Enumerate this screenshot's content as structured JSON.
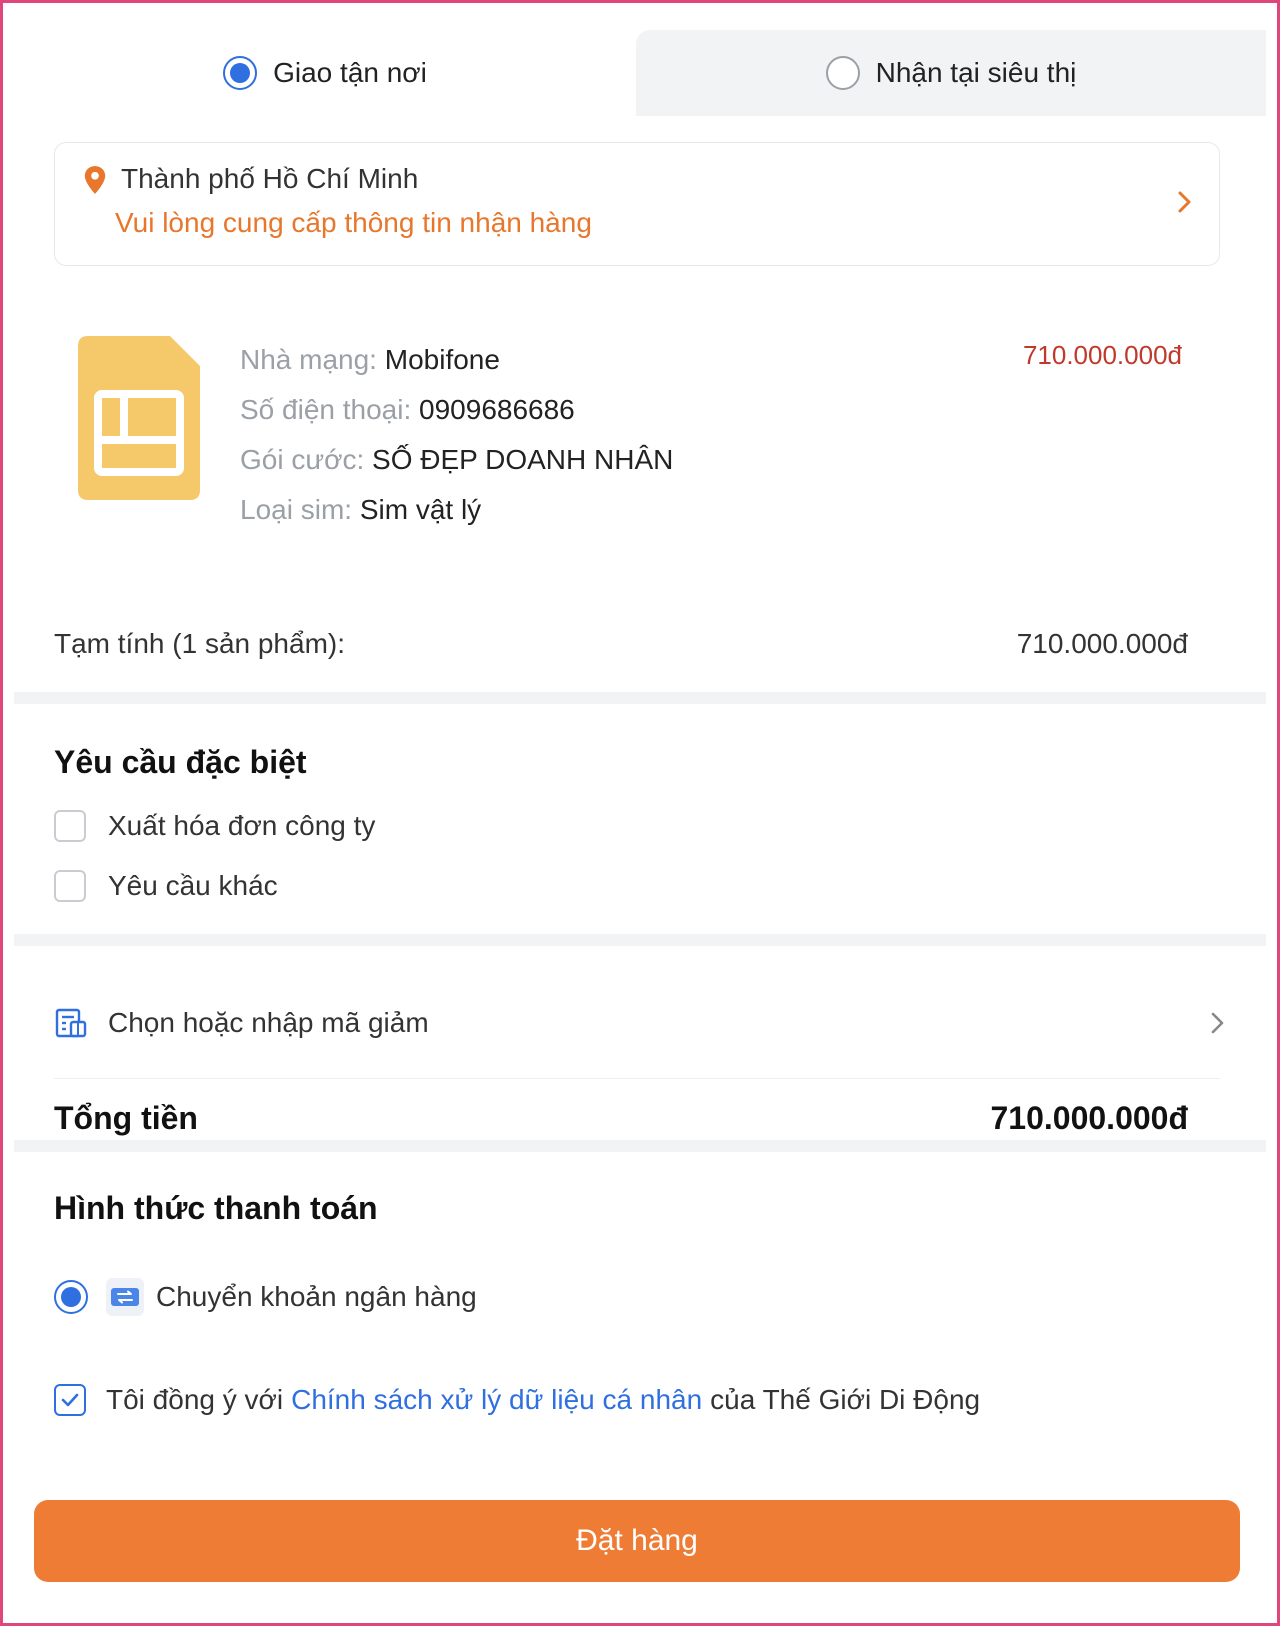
{
  "delivery_tabs": [
    {
      "label": "Giao tận nơi",
      "selected": true
    },
    {
      "label": "Nhận tại siêu thị",
      "selected": false
    }
  ],
  "address": {
    "city": "Thành phố Hồ Chí Minh",
    "warning": "Vui lòng cung cấp thông tin nhận hàng",
    "warning_color": "#e8762b"
  },
  "product": {
    "icon": "sim-card-icon",
    "price": "710.000.000đ",
    "fields": [
      {
        "label": "Nhà mạng:",
        "value": "Mobifone"
      },
      {
        "label": "Số điện thoại:",
        "value": "0909686686"
      },
      {
        "label": "Gói cước:",
        "value": "SỐ ĐẸP DOANH NHÂN"
      },
      {
        "label": "Loại sim:",
        "value": "Sim vật lý"
      }
    ]
  },
  "subtotal": {
    "label": "Tạm tính (1 sản phẩm):",
    "value": "710.000.000đ"
  },
  "special_requests": {
    "title": "Yêu cầu đặc biệt",
    "options": [
      {
        "label": "Xuất hóa đơn công ty",
        "checked": false
      },
      {
        "label": "Yêu cầu khác",
        "checked": false
      }
    ]
  },
  "voucher": {
    "label": "Chọn hoặc nhập mã giảm"
  },
  "total": {
    "label": "Tổng tiền",
    "value": "710.000.000đ"
  },
  "payment": {
    "title": "Hình thức thanh toán",
    "method": "Chuyển khoản ngân hàng",
    "selected": true
  },
  "agreement": {
    "prefix": "Tôi đồng ý với",
    "link": "Chính sách xử lý dữ liệu cá nhân",
    "suffix": "của Thế Giới Di Động",
    "checked": true
  },
  "order_button": {
    "label": "Đặt hàng"
  },
  "colors": {
    "accent_blue": "#2f6fe0",
    "order_orange": "#ee7c34",
    "price_red": "#c0392b",
    "sim_yellow": "#f5c96a"
  }
}
